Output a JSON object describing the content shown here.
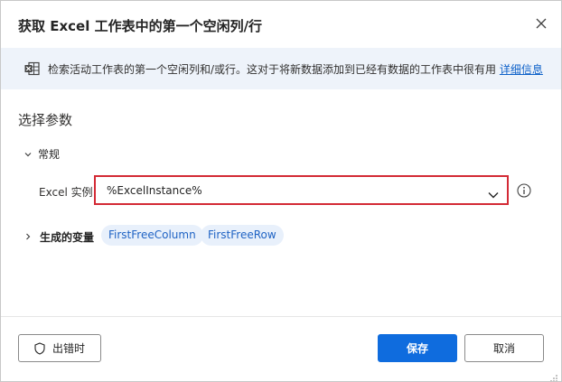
{
  "dialog": {
    "title": "获取 Excel 工作表中的第一个空闲列/行",
    "close_icon": "close-icon"
  },
  "banner": {
    "icon": "excel-icon",
    "text": "检索活动工作表的第一个空闲列和/或行。这对于将新数据添加到已经有数据的工作表中很有用",
    "link": "详细信息"
  },
  "params": {
    "title": "选择参数",
    "general": {
      "label": "常规",
      "expanded": true
    },
    "excel_instance": {
      "label": "Excel 实例:",
      "value": "%ExcelInstance%"
    }
  },
  "variables": {
    "label": "生成的变量",
    "expanded": false,
    "items": [
      "FirstFreeColumn",
      "FirstFreeRow"
    ]
  },
  "footer": {
    "on_error": "出错时",
    "save": "保存",
    "cancel": "取消"
  },
  "colors": {
    "primary": "#0f6cde",
    "highlight_border": "#d32a35",
    "pill_bg": "#e8f0fb",
    "banner_bg": "#eef3fa"
  }
}
